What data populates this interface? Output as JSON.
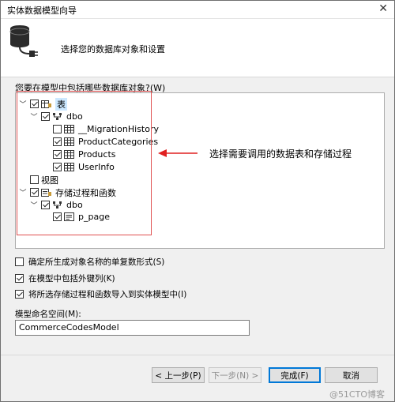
{
  "window": {
    "title": "实体数据模型向导"
  },
  "header": {
    "subtitle": "选择您的数据库对象和设置"
  },
  "tree": {
    "question": "您要在模型中包括哪些数据库对象?(W)",
    "tables_label": "表",
    "dbo1_label": "dbo",
    "tables": [
      "__MigrationHistory",
      "ProductCategories",
      "Products",
      "UserInfo"
    ],
    "views_label": "视图",
    "procs_label": "存储过程和函数",
    "dbo2_label": "dbo",
    "procs": [
      "p_page"
    ]
  },
  "annotation": {
    "text": "选择需要调用的数据表和存储过程"
  },
  "options": {
    "pluralize": "确定所生成对象名称的单复数形式(S)",
    "foreign_keys": "在模型中包括外键列(K)",
    "import_procs": "将所选存储过程和函数导入到实体模型中(I)"
  },
  "namespace": {
    "label": "模型命名空间(M):",
    "value": "CommerceCodesModel"
  },
  "buttons": {
    "back": "< 上一步(P)",
    "next": "下一步(N) >",
    "finish": "完成(F)",
    "cancel": "取消"
  },
  "watermark": "@51CTO博客"
}
